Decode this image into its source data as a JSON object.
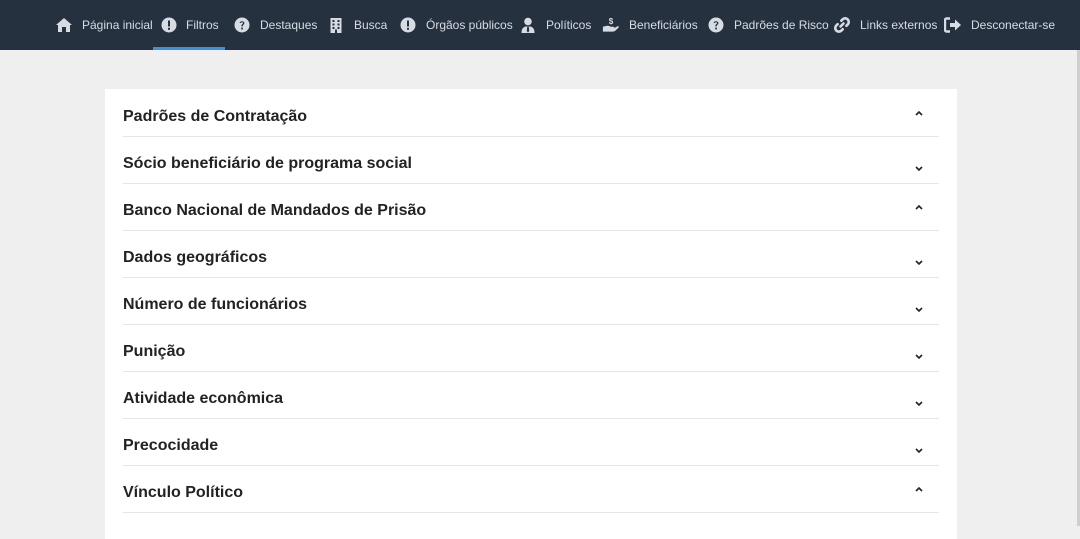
{
  "nav": {
    "items": [
      {
        "label": "Página inicial",
        "icon": "home-icon"
      },
      {
        "label": "Filtros",
        "icon": "exclamation-circle-icon",
        "active": true
      },
      {
        "label": "Destaques",
        "icon": "question-circle-icon"
      },
      {
        "label": "Busca",
        "icon": "building-icon"
      },
      {
        "label": "Órgãos públicos",
        "icon": "exclamation-circle-icon"
      },
      {
        "label": "Políticos",
        "icon": "user-tie-icon"
      },
      {
        "label": "Beneficiários",
        "icon": "hand-holding-dollar-icon"
      },
      {
        "label": "Padrões de Risco",
        "icon": "question-circle-icon"
      },
      {
        "label": "Links externos",
        "icon": "link-icon"
      },
      {
        "label": "Desconectar-se",
        "icon": "sign-out-icon"
      }
    ],
    "background": "#263140",
    "accent": "#3d8fe0"
  },
  "accordion": {
    "items": [
      {
        "title": "Padrões de Contratação",
        "state": "expanded"
      },
      {
        "title": "Sócio beneficiário de programa social",
        "state": "collapsed"
      },
      {
        "title": "Banco Nacional de Mandados de Prisão",
        "state": "expanded"
      },
      {
        "title": "Dados geográficos",
        "state": "collapsed"
      },
      {
        "title": "Número de funcionários",
        "state": "collapsed"
      },
      {
        "title": "Punição",
        "state": "collapsed"
      },
      {
        "title": "Atividade econômica",
        "state": "collapsed"
      },
      {
        "title": "Precocidade",
        "state": "collapsed"
      },
      {
        "title": "Vínculo Político",
        "state": "expanded"
      }
    ]
  }
}
